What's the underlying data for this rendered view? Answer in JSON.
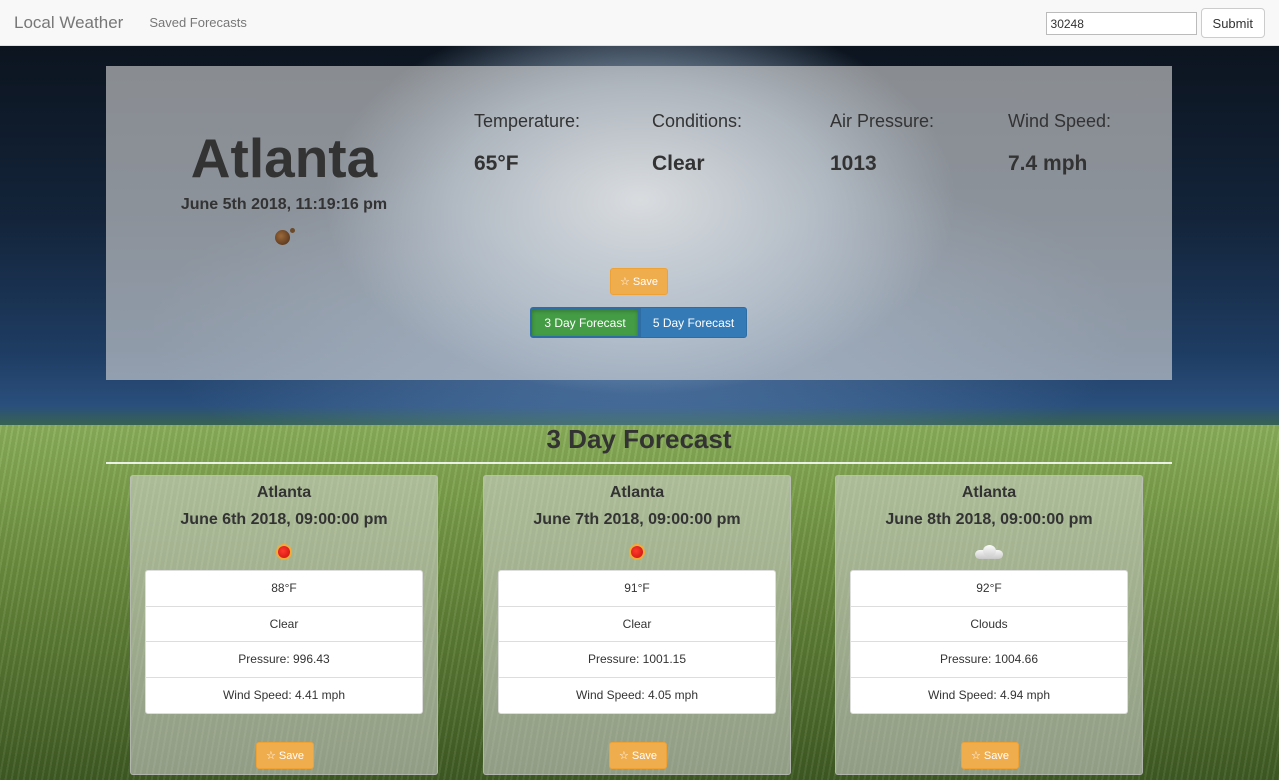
{
  "navbar": {
    "brand": "Local Weather",
    "saved_link": "Saved Forecasts",
    "zip_value": "30248",
    "submit_label": "Submit"
  },
  "current": {
    "city": "Atlanta",
    "datetime": "June 5th 2018, 11:19:16 pm",
    "icon": "moon-icon",
    "stats": [
      {
        "label": "Temperature:",
        "value": "65°F"
      },
      {
        "label": "Conditions:",
        "value": "Clear"
      },
      {
        "label": "Air Pressure:",
        "value": "1013"
      },
      {
        "label": "Wind Speed:",
        "value": "7.4 mph"
      }
    ],
    "save_label": "☆ Save",
    "toggle": {
      "three_day": "3 Day Forecast",
      "five_day": "5 Day Forecast",
      "active": "three_day"
    }
  },
  "forecast": {
    "heading": "3 Day Forecast",
    "cards": [
      {
        "city": "Atlanta",
        "date": "June 6th 2018, 09:00:00 pm",
        "icon": "sun-icon",
        "temp": "88°F",
        "condition": "Clear",
        "pressure": "Pressure: 996.43",
        "wind": "Wind Speed: 4.41 mph",
        "save_label": "☆ Save"
      },
      {
        "city": "Atlanta",
        "date": "June 7th 2018, 09:00:00 pm",
        "icon": "sun-icon",
        "temp": "91°F",
        "condition": "Clear",
        "pressure": "Pressure: 1001.15",
        "wind": "Wind Speed: 4.05 mph",
        "save_label": "☆ Save"
      },
      {
        "city": "Atlanta",
        "date": "June 8th 2018, 09:00:00 pm",
        "icon": "cloud-icon",
        "temp": "92°F",
        "condition": "Clouds",
        "pressure": "Pressure: 1004.66",
        "wind": "Wind Speed: 4.94 mph",
        "save_label": "☆ Save"
      }
    ]
  },
  "colors": {
    "save_button": "#f0ad4e",
    "active_toggle": "#449d44",
    "inactive_toggle": "#337ab7"
  }
}
